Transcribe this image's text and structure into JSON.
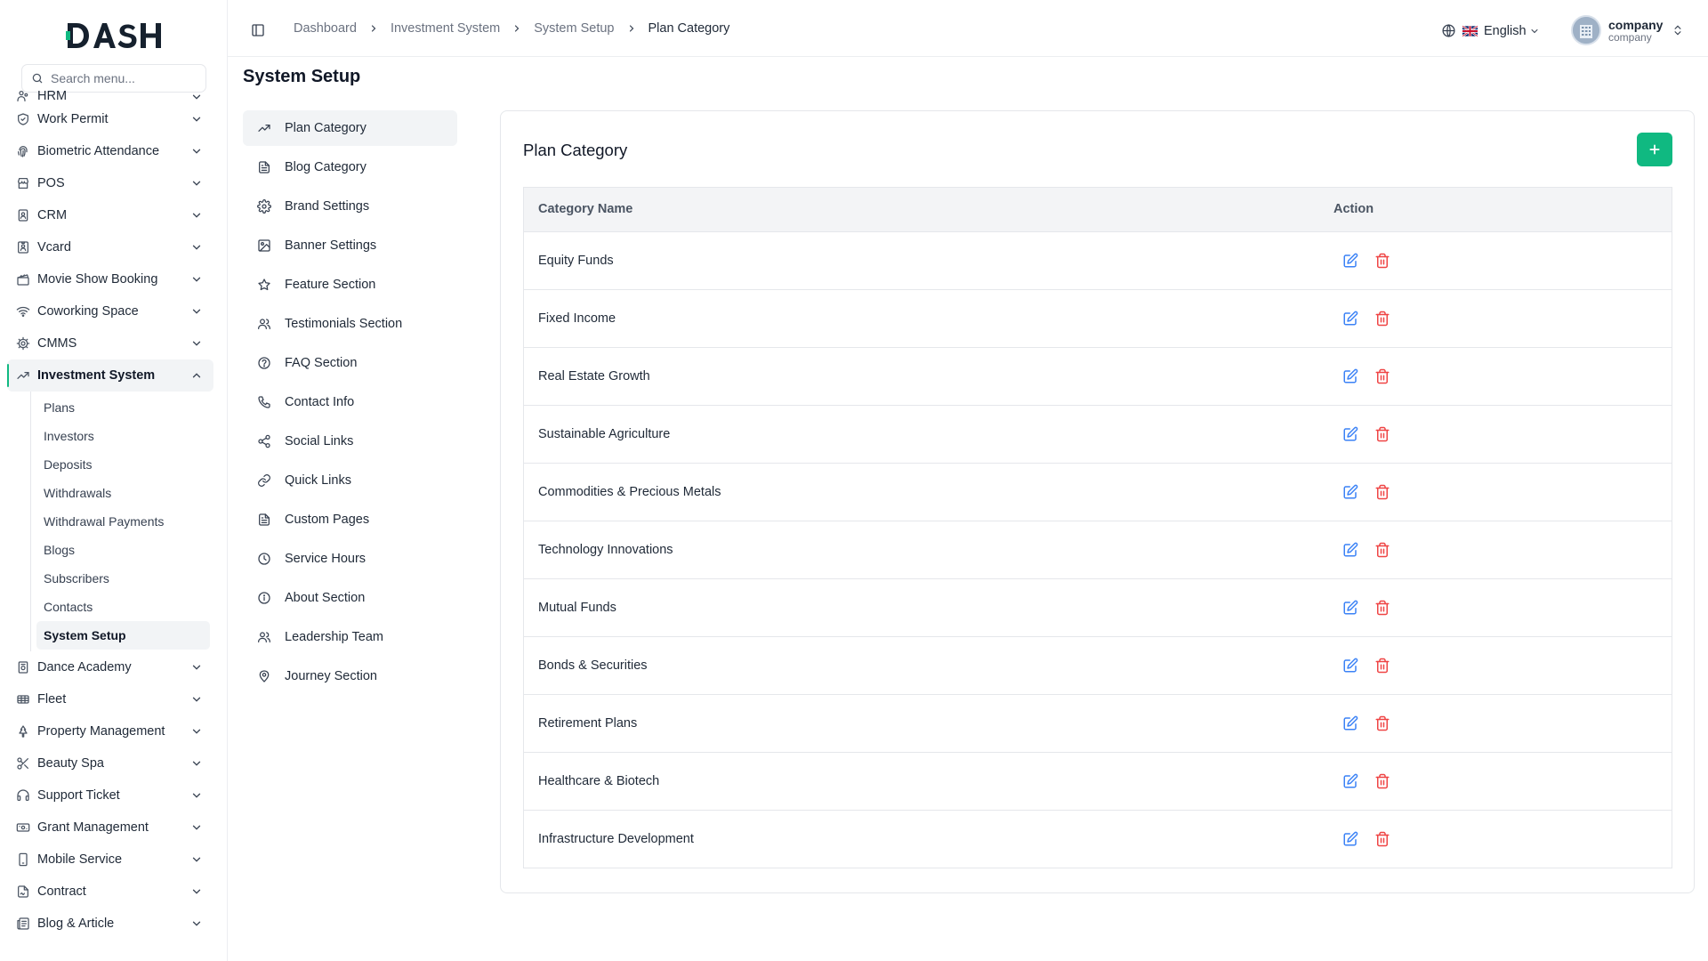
{
  "app": {
    "logo_text": "DASH",
    "search_placeholder": "Search menu..."
  },
  "sidebar": {
    "items": [
      {
        "label": "HRM",
        "icon": "hrm-icon",
        "partial": true
      },
      {
        "label": "Work Permit",
        "icon": "shield-check-icon"
      },
      {
        "label": "Biometric Attendance",
        "icon": "fingerprint-icon"
      },
      {
        "label": "POS",
        "icon": "store-icon"
      },
      {
        "label": "CRM",
        "icon": "contact-book-icon"
      },
      {
        "label": "Vcard",
        "icon": "id-card-icon"
      },
      {
        "label": "Movie Show Booking",
        "icon": "clapperboard-icon"
      },
      {
        "label": "Coworking Space",
        "icon": "wifi-icon"
      },
      {
        "label": "CMMS",
        "icon": "cog-icon"
      },
      {
        "label": "Investment System",
        "icon": "trending-up-icon",
        "active": true,
        "expanded": true,
        "children": [
          "Plans",
          "Investors",
          "Deposits",
          "Withdrawals",
          "Withdrawal Payments",
          "Blogs",
          "Subscribers",
          "Contacts",
          "System Setup"
        ],
        "active_child": "System Setup"
      },
      {
        "label": "Dance Academy",
        "icon": "building-icon"
      },
      {
        "label": "Fleet",
        "icon": "truck-icon"
      },
      {
        "label": "Property Management",
        "icon": "home-icon"
      },
      {
        "label": "Beauty Spa",
        "icon": "scissors-icon"
      },
      {
        "label": "Support Ticket",
        "icon": "headset-icon"
      },
      {
        "label": "Grant Management",
        "icon": "banknote-icon"
      },
      {
        "label": "Mobile Service",
        "icon": "smartphone-icon"
      },
      {
        "label": "Contract",
        "icon": "file-signature-icon"
      },
      {
        "label": "Blog & Article",
        "icon": "newspaper-icon"
      }
    ]
  },
  "header": {
    "breadcrumb": [
      "Dashboard",
      "Investment System",
      "System Setup",
      "Plan Category"
    ],
    "language": "English",
    "language_flag": "uk-flag-icon",
    "user_name": "company",
    "user_role": "company"
  },
  "page": {
    "title": "System Setup"
  },
  "settings_nav": [
    {
      "label": "Plan Category",
      "icon": "trending-up-icon",
      "active": true
    },
    {
      "label": "Blog Category",
      "icon": "file-text-icon"
    },
    {
      "label": "Brand Settings",
      "icon": "gear-icon"
    },
    {
      "label": "Banner Settings",
      "icon": "image-icon"
    },
    {
      "label": "Feature Section",
      "icon": "star-icon"
    },
    {
      "label": "Testimonials Section",
      "icon": "users-icon"
    },
    {
      "label": "FAQ Section",
      "icon": "help-circle-icon"
    },
    {
      "label": "Contact Info",
      "icon": "phone-icon"
    },
    {
      "label": "Social Links",
      "icon": "share-icon"
    },
    {
      "label": "Quick Links",
      "icon": "link-icon"
    },
    {
      "label": "Custom Pages",
      "icon": "file-text-icon"
    },
    {
      "label": "Service Hours",
      "icon": "clock-icon"
    },
    {
      "label": "About Section",
      "icon": "info-icon"
    },
    {
      "label": "Leadership Team",
      "icon": "users-icon"
    },
    {
      "label": "Journey Section",
      "icon": "map-pin-icon"
    }
  ],
  "card": {
    "title": "Plan Category",
    "add_button_icon": "plus-icon",
    "columns": [
      "Category Name",
      "Action"
    ],
    "rows": [
      "Equity Funds",
      "Fixed Income",
      "Real Estate Growth",
      "Sustainable Agriculture",
      "Commodities & Precious Metals",
      "Technology Innovations",
      "Mutual Funds",
      "Bonds & Securities",
      "Retirement Plans",
      "Healthcare & Biotech",
      "Infrastructure Development"
    ]
  },
  "colors": {
    "accent": "#10b981",
    "edit": "#3b82f6",
    "delete": "#ef4444"
  }
}
